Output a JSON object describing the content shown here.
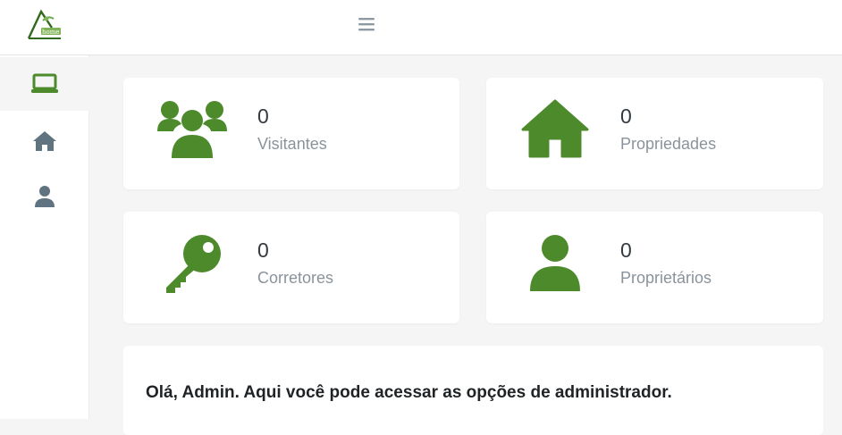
{
  "brand": {
    "logo_text": "home",
    "accent_color": "#4c8a2b"
  },
  "sidebar": {
    "items": [
      {
        "icon": "laptop-icon",
        "active": true
      },
      {
        "icon": "home-icon",
        "active": false
      },
      {
        "icon": "user-icon",
        "active": false
      }
    ],
    "active_color": "#4c8a2b",
    "icon_color": "#5f7380"
  },
  "stats": [
    {
      "count": "0",
      "label": "Visitantes",
      "icon": "users-icon"
    },
    {
      "count": "0",
      "label": "Propriedades",
      "icon": "house-icon"
    },
    {
      "count": "0",
      "label": "Corretores",
      "icon": "key-icon"
    },
    {
      "count": "0",
      "label": "Proprietários",
      "icon": "user-icon"
    }
  ],
  "welcome": {
    "message": "Olá, Admin. Aqui você pode acessar as opções de administrador."
  }
}
